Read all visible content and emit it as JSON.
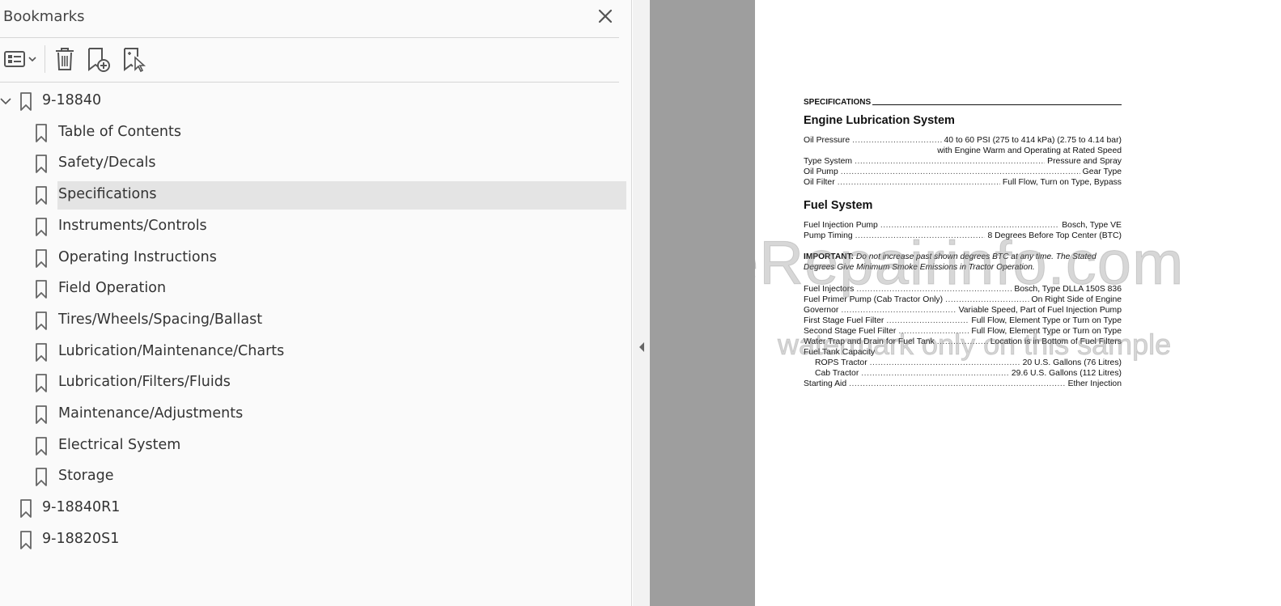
{
  "panel": {
    "title": "Bookmarks",
    "close_icon": "close-icon",
    "toolbar": {
      "options_icon": "options-list-icon",
      "delete_icon": "trash-icon",
      "add_icon": "add-bookmark-icon",
      "new_from_selection_icon": "new-bookmark-from-selection-icon"
    },
    "bookmarks": [
      {
        "label": "9-18840",
        "level": 0,
        "expanded": true
      },
      {
        "label": "Table of Contents",
        "level": 1
      },
      {
        "label": "Safety/Decals",
        "level": 1
      },
      {
        "label": "Specifications",
        "level": 1,
        "selected": true
      },
      {
        "label": "Instruments/Controls",
        "level": 1
      },
      {
        "label": "Operating Instructions",
        "level": 1
      },
      {
        "label": "Field Operation",
        "level": 1
      },
      {
        "label": "Tires/Wheels/Spacing/Ballast",
        "level": 1
      },
      {
        "label": "Lubrication/Maintenance/Charts",
        "level": 1
      },
      {
        "label": "Lubrication/Filters/Fluids",
        "level": 1
      },
      {
        "label": "Maintenance/Adjustments",
        "level": 1
      },
      {
        "label": "Electrical System",
        "level": 1
      },
      {
        "label": "Storage",
        "level": 1
      },
      {
        "label": "9-18840R1",
        "level": 0
      },
      {
        "label": "9-18820S1",
        "level": 0
      }
    ]
  },
  "viewer": {
    "collapse_icon": "collapse-left-arrow-icon",
    "page_bg": "#ffffff",
    "gray_bg": "#9e9e9e"
  },
  "doc": {
    "header": "SPECIFICATIONS",
    "section1": {
      "title": "Engine Lubrication System",
      "rows": [
        {
          "k": "Oil Pressure",
          "v": "40 to 60 PSI (275 to 414 kPa) (2.75 to 4.14 bar)"
        },
        {
          "cont": "with Engine Warm and Operating at Rated Speed"
        },
        {
          "k": "Type System",
          "v": "Pressure and Spray"
        },
        {
          "k": "Oil Pump",
          "v": "Gear Type"
        },
        {
          "k": "Oil Filter",
          "v": "Full Flow, Turn on Type, Bypass"
        }
      ]
    },
    "section2": {
      "title": "Fuel System",
      "rows_a": [
        {
          "k": "Fuel Injection Pump",
          "v": "Bosch, Type VE"
        },
        {
          "k": "Pump Timing",
          "v": "8 Degrees Before Top Center (BTC)"
        }
      ],
      "important_label": "IMPORTANT:",
      "important_text": " Do not increase past shown degrees BTC at any time. The Stated Degrees Give Minimum Smoke Emissions in Tractor Operation.",
      "rows_b": [
        {
          "k": "Fuel Injectors",
          "v": "Bosch, Type DLLA 150S 836"
        },
        {
          "k": "Fuel Primer Pump (Cab Tractor Only)",
          "v": "On Right Side of Engine"
        },
        {
          "k": "Governor",
          "v": "Variable Speed, Part of Fuel Injection Pump"
        },
        {
          "k": "First Stage Fuel Filter",
          "v": "Full Flow, Element Type or Turn on Type"
        },
        {
          "k": "Second Stage Fuel Filter",
          "v": "Full Flow, Element Type or Turn on Type"
        },
        {
          "k": "Water Trap and Drain for Fuel Tank",
          "v": "Location is in Bottom of Fuel Filters"
        },
        {
          "k": "Fuel Tank Capacity",
          "v": ""
        },
        {
          "k": "ROPS Tractor",
          "v": "20 U.S. Gallons (76 Litres)",
          "indent": true
        },
        {
          "k": "Cab Tractor",
          "v": "29.6 U.S. Gallons (112 Litres)",
          "indent": true
        },
        {
          "k": "Starting Aid",
          "v": "Ether Injection"
        }
      ]
    },
    "watermark_main": "eRepairinfo.com",
    "watermark_sub": "watermark only on this sample"
  }
}
